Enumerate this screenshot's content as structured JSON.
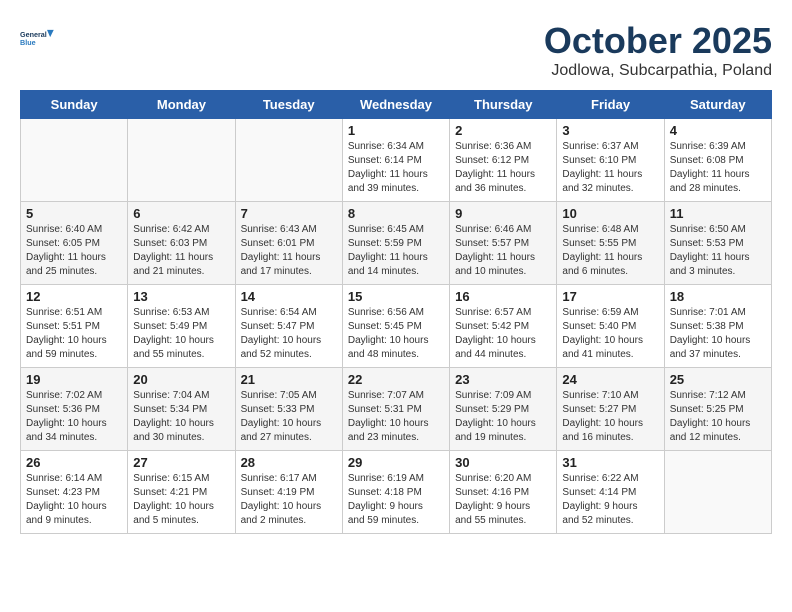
{
  "header": {
    "logo_line1": "General",
    "logo_line2": "Blue",
    "month": "October 2025",
    "location": "Jodlowa, Subcarpathia, Poland"
  },
  "weekdays": [
    "Sunday",
    "Monday",
    "Tuesday",
    "Wednesday",
    "Thursday",
    "Friday",
    "Saturday"
  ],
  "weeks": [
    [
      {
        "day": "",
        "info": ""
      },
      {
        "day": "",
        "info": ""
      },
      {
        "day": "",
        "info": ""
      },
      {
        "day": "1",
        "info": "Sunrise: 6:34 AM\nSunset: 6:14 PM\nDaylight: 11 hours\nand 39 minutes."
      },
      {
        "day": "2",
        "info": "Sunrise: 6:36 AM\nSunset: 6:12 PM\nDaylight: 11 hours\nand 36 minutes."
      },
      {
        "day": "3",
        "info": "Sunrise: 6:37 AM\nSunset: 6:10 PM\nDaylight: 11 hours\nand 32 minutes."
      },
      {
        "day": "4",
        "info": "Sunrise: 6:39 AM\nSunset: 6:08 PM\nDaylight: 11 hours\nand 28 minutes."
      }
    ],
    [
      {
        "day": "5",
        "info": "Sunrise: 6:40 AM\nSunset: 6:05 PM\nDaylight: 11 hours\nand 25 minutes."
      },
      {
        "day": "6",
        "info": "Sunrise: 6:42 AM\nSunset: 6:03 PM\nDaylight: 11 hours\nand 21 minutes."
      },
      {
        "day": "7",
        "info": "Sunrise: 6:43 AM\nSunset: 6:01 PM\nDaylight: 11 hours\nand 17 minutes."
      },
      {
        "day": "8",
        "info": "Sunrise: 6:45 AM\nSunset: 5:59 PM\nDaylight: 11 hours\nand 14 minutes."
      },
      {
        "day": "9",
        "info": "Sunrise: 6:46 AM\nSunset: 5:57 PM\nDaylight: 11 hours\nand 10 minutes."
      },
      {
        "day": "10",
        "info": "Sunrise: 6:48 AM\nSunset: 5:55 PM\nDaylight: 11 hours\nand 6 minutes."
      },
      {
        "day": "11",
        "info": "Sunrise: 6:50 AM\nSunset: 5:53 PM\nDaylight: 11 hours\nand 3 minutes."
      }
    ],
    [
      {
        "day": "12",
        "info": "Sunrise: 6:51 AM\nSunset: 5:51 PM\nDaylight: 10 hours\nand 59 minutes."
      },
      {
        "day": "13",
        "info": "Sunrise: 6:53 AM\nSunset: 5:49 PM\nDaylight: 10 hours\nand 55 minutes."
      },
      {
        "day": "14",
        "info": "Sunrise: 6:54 AM\nSunset: 5:47 PM\nDaylight: 10 hours\nand 52 minutes."
      },
      {
        "day": "15",
        "info": "Sunrise: 6:56 AM\nSunset: 5:45 PM\nDaylight: 10 hours\nand 48 minutes."
      },
      {
        "day": "16",
        "info": "Sunrise: 6:57 AM\nSunset: 5:42 PM\nDaylight: 10 hours\nand 44 minutes."
      },
      {
        "day": "17",
        "info": "Sunrise: 6:59 AM\nSunset: 5:40 PM\nDaylight: 10 hours\nand 41 minutes."
      },
      {
        "day": "18",
        "info": "Sunrise: 7:01 AM\nSunset: 5:38 PM\nDaylight: 10 hours\nand 37 minutes."
      }
    ],
    [
      {
        "day": "19",
        "info": "Sunrise: 7:02 AM\nSunset: 5:36 PM\nDaylight: 10 hours\nand 34 minutes."
      },
      {
        "day": "20",
        "info": "Sunrise: 7:04 AM\nSunset: 5:34 PM\nDaylight: 10 hours\nand 30 minutes."
      },
      {
        "day": "21",
        "info": "Sunrise: 7:05 AM\nSunset: 5:33 PM\nDaylight: 10 hours\nand 27 minutes."
      },
      {
        "day": "22",
        "info": "Sunrise: 7:07 AM\nSunset: 5:31 PM\nDaylight: 10 hours\nand 23 minutes."
      },
      {
        "day": "23",
        "info": "Sunrise: 7:09 AM\nSunset: 5:29 PM\nDaylight: 10 hours\nand 19 minutes."
      },
      {
        "day": "24",
        "info": "Sunrise: 7:10 AM\nSunset: 5:27 PM\nDaylight: 10 hours\nand 16 minutes."
      },
      {
        "day": "25",
        "info": "Sunrise: 7:12 AM\nSunset: 5:25 PM\nDaylight: 10 hours\nand 12 minutes."
      }
    ],
    [
      {
        "day": "26",
        "info": "Sunrise: 6:14 AM\nSunset: 4:23 PM\nDaylight: 10 hours\nand 9 minutes."
      },
      {
        "day": "27",
        "info": "Sunrise: 6:15 AM\nSunset: 4:21 PM\nDaylight: 10 hours\nand 5 minutes."
      },
      {
        "day": "28",
        "info": "Sunrise: 6:17 AM\nSunset: 4:19 PM\nDaylight: 10 hours\nand 2 minutes."
      },
      {
        "day": "29",
        "info": "Sunrise: 6:19 AM\nSunset: 4:18 PM\nDaylight: 9 hours\nand 59 minutes."
      },
      {
        "day": "30",
        "info": "Sunrise: 6:20 AM\nSunset: 4:16 PM\nDaylight: 9 hours\nand 55 minutes."
      },
      {
        "day": "31",
        "info": "Sunrise: 6:22 AM\nSunset: 4:14 PM\nDaylight: 9 hours\nand 52 minutes."
      },
      {
        "day": "",
        "info": ""
      }
    ]
  ]
}
